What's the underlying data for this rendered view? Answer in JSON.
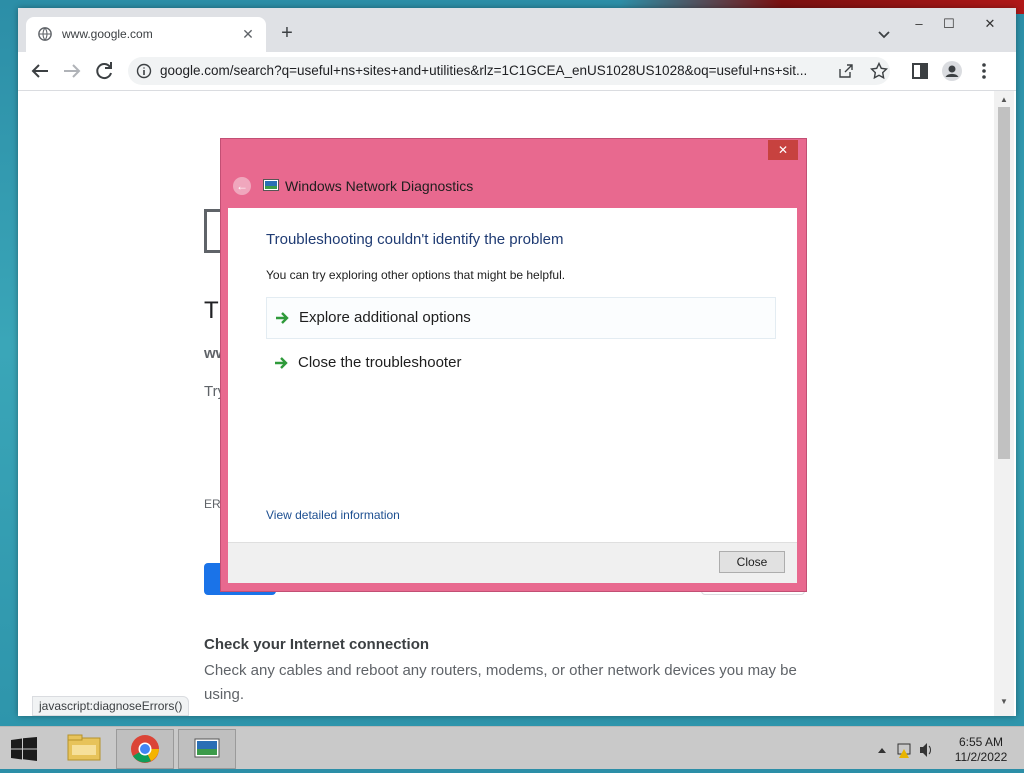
{
  "browser": {
    "tab": {
      "title": "www.google.com"
    },
    "window_controls": {
      "minimize": "–",
      "maximize": "☐",
      "close": "✕"
    },
    "omnibox": {
      "url": "google.com/search?q=useful+ns+sites+and+utilities&rlz=1C1GCEA_enUS1028US1028&oq=useful+ns+sit..."
    },
    "status_url": "javascript:diagnoseErrors()"
  },
  "page": {
    "heading_fragment": "Th",
    "domain_fragment": "ww",
    "try_fragment": "Try",
    "error_code_fragment": "ERR",
    "check_title": "Check your Internet connection",
    "check_body": "Check any cables and reboot any routers, modems, or other network devices you may be using."
  },
  "dialog": {
    "title": "Windows Network Diagnostics",
    "close_glyph": "✕",
    "back_glyph": "←",
    "heading": "Troubleshooting couldn't identify the problem",
    "subtitle": "You can try exploring other options that might be helpful.",
    "options": [
      {
        "label": "Explore additional options"
      },
      {
        "label": "Close the troubleshooter"
      }
    ],
    "details_link": "View detailed information",
    "close_button": "Close"
  },
  "taskbar": {
    "items": [
      "start-button",
      "file-explorer",
      "chrome",
      "network-diagnostics"
    ],
    "clock": {
      "time": "6:55 AM",
      "date": "11/2/2022"
    }
  },
  "colors": {
    "dialog_frame": "#e8698f",
    "accent_blue": "#1a73e8",
    "arrow_green": "#2e9a3a"
  }
}
